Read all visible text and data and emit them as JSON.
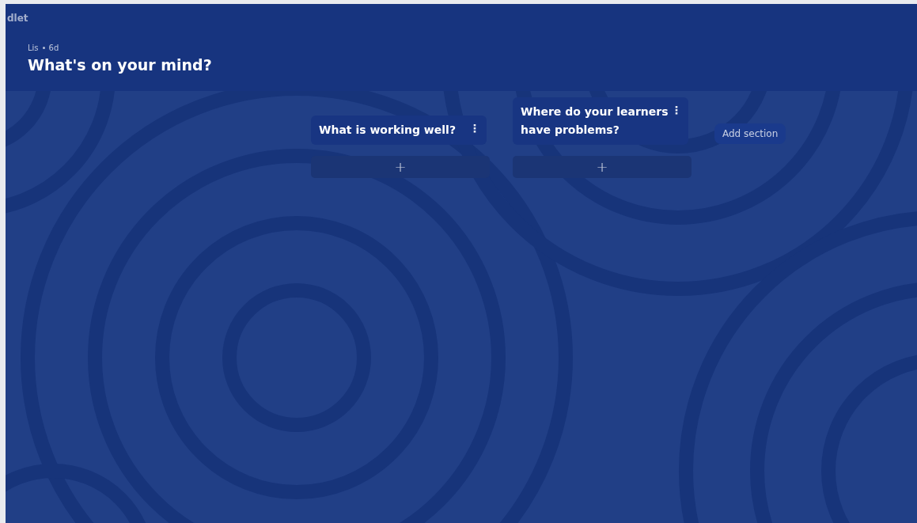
{
  "logo": "dlet",
  "header": {
    "author": "Lis",
    "age": "6d",
    "title": "What's on your mind?"
  },
  "sections": [
    {
      "title": "What is working well?",
      "menu": "⋮",
      "add": "+"
    },
    {
      "title": "Where do your learners have problems?",
      "menu": "⋮",
      "add": "+"
    }
  ],
  "add_section": "Add section"
}
